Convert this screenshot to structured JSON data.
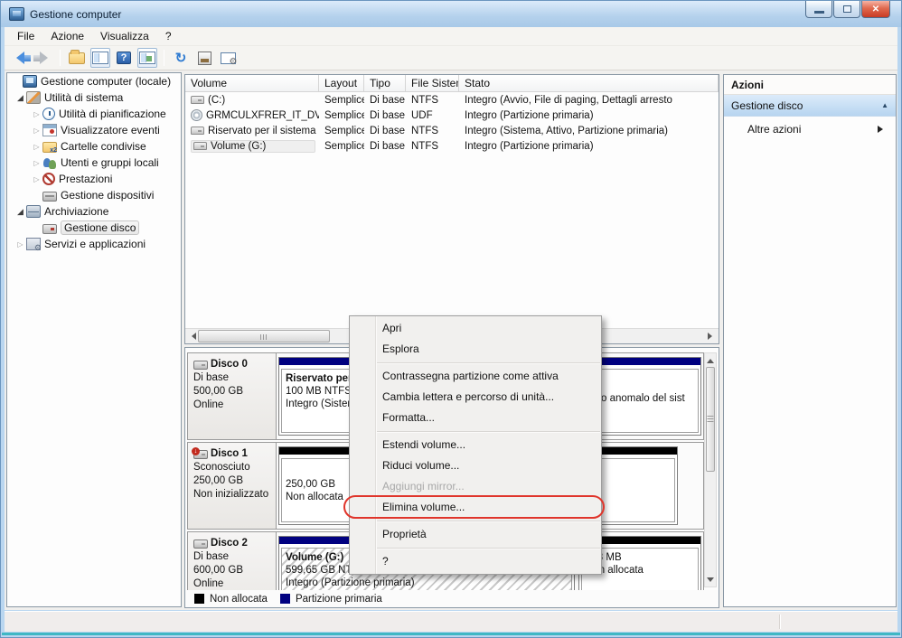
{
  "window": {
    "title": "Gestione computer"
  },
  "menu_bar": {
    "items": [
      "File",
      "Azione",
      "Visualizza",
      "?"
    ]
  },
  "toolbar": {
    "icons": [
      "back",
      "forward",
      "export-folder",
      "show-hide-console-tree",
      "help",
      "show-hide-action-pane",
      "refresh",
      "properties",
      "console-window"
    ]
  },
  "tree": {
    "items": [
      {
        "label": "Gestione computer (locale)"
      },
      {
        "label": "Utilità di sistema"
      },
      {
        "label": "Utilità di pianificazione"
      },
      {
        "label": "Visualizzatore eventi"
      },
      {
        "label": "Cartelle condivise"
      },
      {
        "label": "Utenti e gruppi locali"
      },
      {
        "label": "Prestazioni"
      },
      {
        "label": "Gestione dispositivi"
      },
      {
        "label": "Archiviazione"
      },
      {
        "label": "Gestione disco",
        "selected": true
      },
      {
        "label": "Servizi e applicazioni"
      }
    ]
  },
  "volume_table": {
    "columns": [
      "Volume",
      "Layout",
      "Tipo",
      "File Sistema",
      "Stato"
    ],
    "rows": [
      {
        "name": "(C:)",
        "layout": "Semplice",
        "tipo": "Di base",
        "fs": "NTFS",
        "stato": "Integro (Avvio, File di paging, Dettagli arresto"
      },
      {
        "name": "GRMCULXFRER_IT_DVD (D:)",
        "layout": "Semplice",
        "tipo": "Di base",
        "fs": "UDF",
        "stato": "Integro (Partizione primaria)"
      },
      {
        "name": "Riservato per il sistema",
        "layout": "Semplice",
        "tipo": "Di base",
        "fs": "NTFS",
        "stato": "Integro (Sistema, Attivo, Partizione primaria)"
      },
      {
        "name": "Volume (G:)",
        "layout": "Semplice",
        "tipo": "Di base",
        "fs": "NTFS",
        "stato": "Integro (Partizione primaria)",
        "selected": true
      }
    ]
  },
  "context_menu": {
    "items": [
      {
        "label": "Apri"
      },
      {
        "label": "Esplora"
      },
      {
        "label": "Contrassegna partizione come attiva"
      },
      {
        "label": "Cambia lettera e percorso di unità..."
      },
      {
        "label": "Formatta..."
      },
      {
        "label": "Estendi volume..."
      },
      {
        "label": "Riduci volume..."
      },
      {
        "label": "Aggiungi mirror...",
        "disabled": true
      },
      {
        "label": "Elimina volume...",
        "annotated": true
      },
      {
        "label": "Proprietà"
      },
      {
        "label": "?"
      }
    ],
    "annotation_color": "#E0352B"
  },
  "disks": [
    {
      "name": "Disco 0",
      "line1": "Di base",
      "line2": "500,00 GB",
      "line3": "Online",
      "partitions": [
        {
          "name": "Riservato per il sistema",
          "size": "100 MB NTFS",
          "status": "Integro (Sistema, Attivo, Partizione primaria)"
        },
        {
          "visible_fragment": "o anomalo del sist"
        }
      ]
    },
    {
      "name": "Disco 1",
      "line1": "Sconosciuto",
      "line2": "250,00 GB",
      "line3": "Non inizializzato",
      "partitions": [
        {
          "size": "250,00 GB",
          "status": "Non allocata"
        }
      ]
    },
    {
      "name": "Disco 2",
      "line1": "Di base",
      "line2": "600,00 GB",
      "line3": "Online",
      "partitions": [
        {
          "name": "Volume (G:)",
          "size": "599,65 GB NTFS",
          "status": "Integro (Partizione primaria)"
        },
        {
          "size": "358 MB",
          "status": "Non allocata"
        }
      ]
    }
  ],
  "legend": {
    "items": [
      {
        "label": "Non allocata",
        "color": "#000000"
      },
      {
        "label": "Partizione primaria",
        "color": "#000080"
      }
    ]
  },
  "actions": {
    "title": "Azioni",
    "group_label": "Gestione disco",
    "more_label": "Altre azioni"
  },
  "colors": {
    "primary_partition": "#000080",
    "unallocated": "#000000",
    "titlebar": "#BDD9F1"
  }
}
